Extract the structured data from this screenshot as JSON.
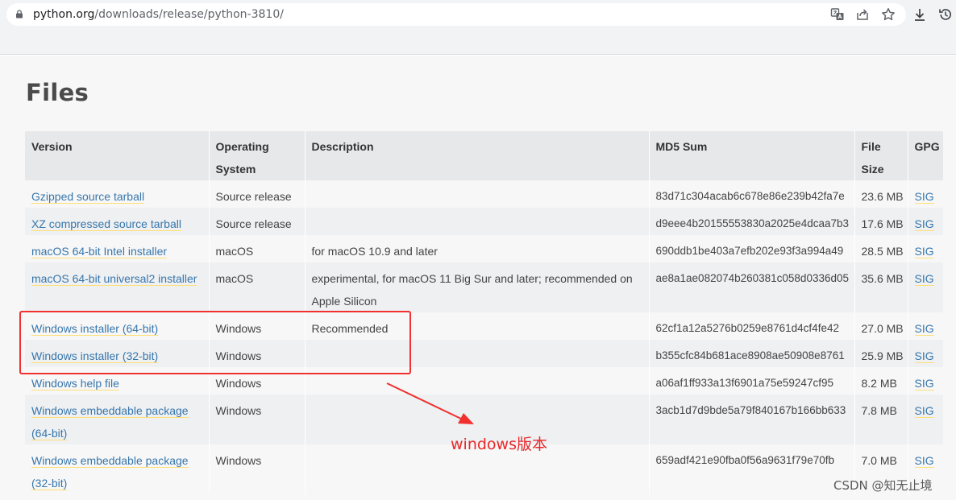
{
  "browser": {
    "url_host": "python.org",
    "url_path": "/downloads/release/python-3810/",
    "icons": [
      "lock-icon",
      "translate-icon",
      "share-icon",
      "bookmark-star-icon",
      "download-icon",
      "history-icon"
    ]
  },
  "page": {
    "title": "Files",
    "table": {
      "headers": {
        "version": "Version",
        "os": "Operating System",
        "description": "Description",
        "md5": "MD5 Sum",
        "size": "File Size",
        "gpg": "GPG"
      },
      "rows": [
        {
          "version": "Gzipped source tarball",
          "os": "Source release",
          "description": "",
          "md5": "83d71c304acab6c678e86e239b42fa7e",
          "size": "23.6 MB",
          "gpg": "SIG"
        },
        {
          "version": "XZ compressed source tarball",
          "os": "Source release",
          "description": "",
          "md5": "d9eee4b20155553830a2025e4dcaa7b3",
          "size": "17.6 MB",
          "gpg": "SIG"
        },
        {
          "version": "macOS 64-bit Intel installer",
          "os": "macOS",
          "description": "for macOS 10.9 and later",
          "md5": "690ddb1be403a7efb202e93f3a994a49",
          "size": "28.5 MB",
          "gpg": "SIG"
        },
        {
          "version": "macOS 64-bit universal2 installer",
          "os": "macOS",
          "description": "experimental, for macOS 11 Big Sur and later; recommended on Apple Silicon",
          "md5": "ae8a1ae082074b260381c058d0336d05",
          "size": "35.6 MB",
          "gpg": "SIG"
        },
        {
          "version": "Windows installer (64-bit)",
          "os": "Windows",
          "description": "Recommended",
          "md5": "62cf1a12a5276b0259e8761d4cf4fe42",
          "size": "27.0 MB",
          "gpg": "SIG"
        },
        {
          "version": "Windows installer (32-bit)",
          "os": "Windows",
          "description": "",
          "md5": "b355cfc84b681ace8908ae50908e8761",
          "size": "25.9 MB",
          "gpg": "SIG"
        },
        {
          "version": "Windows help file",
          "os": "Windows",
          "description": "",
          "md5": "a06af1ff933a13f6901a75e59247cf95",
          "size": "8.2 MB",
          "gpg": "SIG"
        },
        {
          "version": "Windows embeddable package (64-bit)",
          "os": "Windows",
          "description": "",
          "md5": "3acb1d7d9bde5a79f840167b166bb633",
          "size": "7.8 MB",
          "gpg": "SIG"
        },
        {
          "version": "Windows embeddable package (32-bit)",
          "os": "Windows",
          "description": "",
          "md5": "659adf421e90fba0f56a9631f79e70fb",
          "size": "7.0 MB",
          "gpg": "SIG"
        }
      ]
    }
  },
  "annotation": {
    "label": "windows版本",
    "color": "#e8282a"
  },
  "watermark": "CSDN @知无止境",
  "colors": {
    "link": "#3776ab",
    "link_underline": "#ffdf76",
    "header_bg": "#e6e8ea",
    "highlight": "#f23030"
  }
}
